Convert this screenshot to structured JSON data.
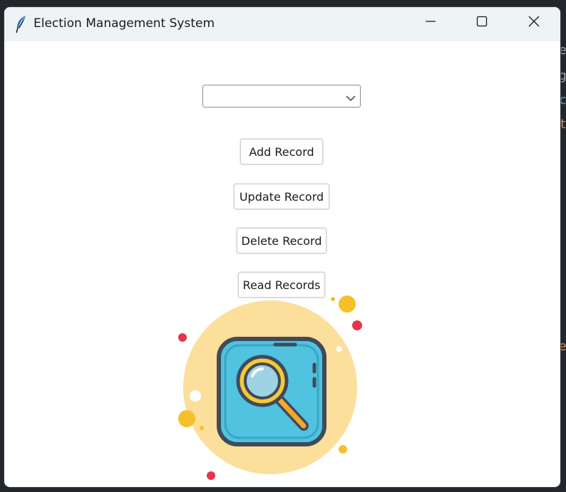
{
  "window": {
    "title": "Election Management System",
    "controls": {
      "minimize": "minimize-icon",
      "maximize": "maximize-icon",
      "close": "close-icon"
    }
  },
  "form": {
    "record_select": {
      "value": "",
      "options_visible": []
    },
    "buttons": {
      "add": "Add Record",
      "update": "Update Record",
      "delete": "Delete Record",
      "read": "Read Records"
    }
  },
  "illustration": {
    "icon": "magnifier-search-icon"
  },
  "colors": {
    "titlebar": "#eef3f6",
    "window_bg": "#ffffff",
    "circle_bg": "#fbdf9b",
    "tile_blue": "#4fc3e0",
    "tile_outline": "#414a5a",
    "lens_yellow": "#f6c937",
    "accent_red": "#e8334a"
  }
}
